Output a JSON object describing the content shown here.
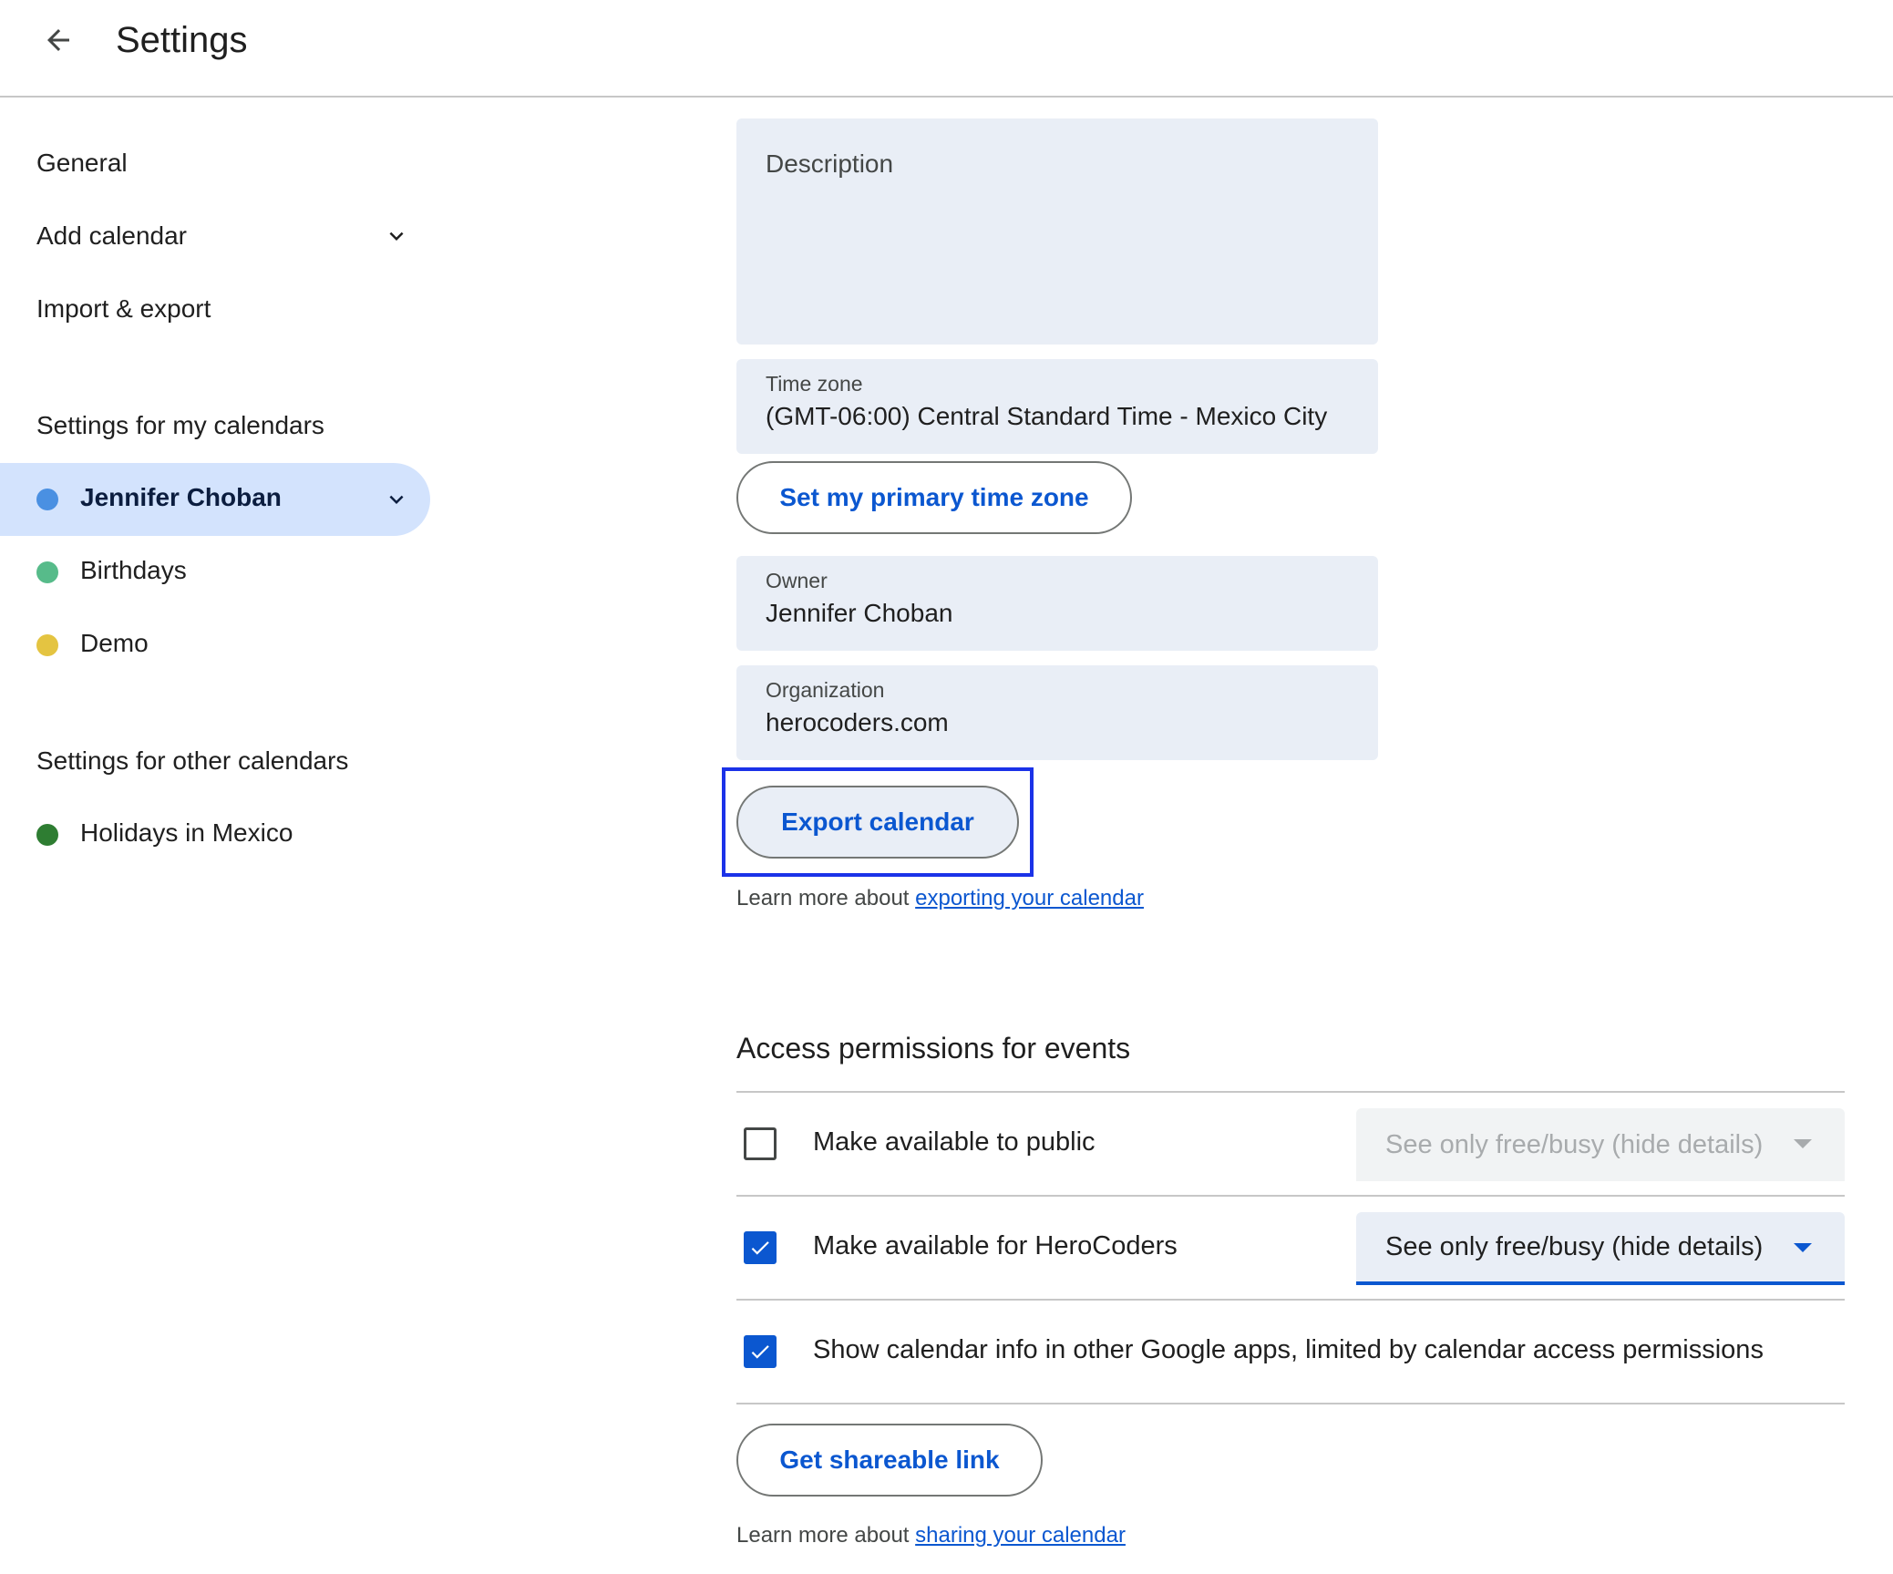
{
  "header": {
    "title": "Settings",
    "back_icon": "arrow-back-icon"
  },
  "sidebar": {
    "general": "General",
    "add_calendar": "Add calendar",
    "import_export": "Import & export",
    "my_calendars_heading": "Settings for my calendars",
    "my_calendars": [
      {
        "label": "Jennifer Choban",
        "color": "#4a90e2",
        "active": true
      },
      {
        "label": "Birthdays",
        "color": "#57bb8a"
      },
      {
        "label": "Demo",
        "color": "#e4c441"
      }
    ],
    "other_calendars_heading": "Settings for other calendars",
    "other_calendars": [
      {
        "label": "Holidays in Mexico",
        "color": "#2e7d32"
      }
    ]
  },
  "main": {
    "description_placeholder": "Description",
    "timezone": {
      "label": "Time zone",
      "value": "(GMT-06:00) Central Standard Time - Mexico City"
    },
    "set_primary_tz_button": "Set my primary time zone",
    "owner": {
      "label": "Owner",
      "value": "Jennifer Choban"
    },
    "organization": {
      "label": "Organization",
      "value": "herocoders.com"
    },
    "export_button": "Export calendar",
    "export_learn_prefix": "Learn more about",
    "export_learn_link": "exporting your calendar",
    "access": {
      "title": "Access permissions for events",
      "public_label": "Make available to public",
      "public_checked": false,
      "public_select": "See only free/busy (hide details)",
      "org_label": "Make available for HeroCoders",
      "org_checked": true,
      "org_select": "See only free/busy (hide details)",
      "google_apps_label": "Show calendar info in other Google apps, limited by calendar access permissions",
      "google_apps_checked": true,
      "share_button": "Get shareable link",
      "share_learn_prefix": "Learn more about",
      "share_learn_link": "sharing your calendar"
    }
  },
  "colors": {
    "accent": "#0b57d0",
    "field_bg": "#e9eef6",
    "active_nav_bg": "#d3e3fd",
    "highlight": "#1b32e8"
  }
}
